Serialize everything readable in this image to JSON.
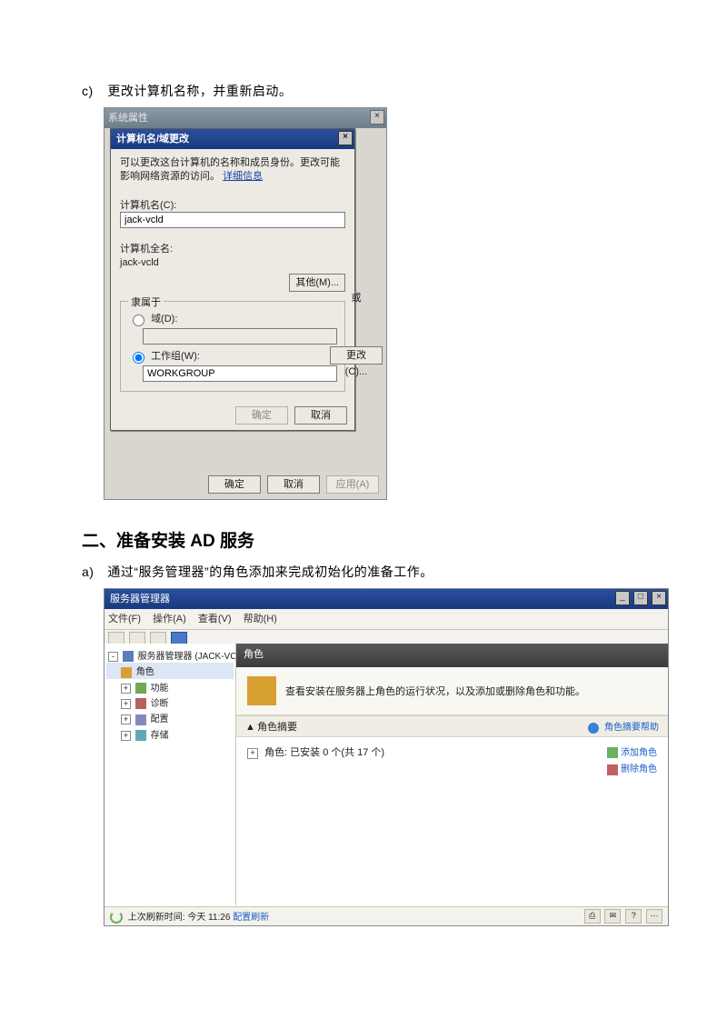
{
  "step_c": {
    "label": "c)",
    "text": "更改计算机名称，并重新启动。"
  },
  "shot1": {
    "outer_title": "系统属性",
    "inner_title": "计算机名/域更改",
    "desc_prefix": "可以更改这台计算机的名称和成员身份。更改可能影响网络资源的访问。",
    "desc_link": "详细信息",
    "computer_name_label": "计算机名(C):",
    "computer_name_value": "jack-vcld",
    "full_name_label": "计算机全名:",
    "full_name_value": "jack-vcld",
    "more_btn": "其他(M)...",
    "member_legend": "隶属于",
    "domain_radio": "域(D):",
    "workgroup_radio": "工作组(W):",
    "workgroup_value": "WORKGROUP",
    "ok": "确定",
    "cancel": "取消",
    "apply": "应用(A)",
    "outer_side_or": "或",
    "outer_side_change": "更改(C)..."
  },
  "heading2": "二、准备安装 AD 服务",
  "step_a": {
    "label": "a)",
    "text": "通过“服务管理器”的角色添加来完成初始化的准备工作。"
  },
  "shot2": {
    "title": "服务器管理器",
    "menu": {
      "file": "文件(F)",
      "action": "操作(A)",
      "view": "查看(V)",
      "help": "帮助(H)"
    },
    "tree": {
      "root": "服务器管理器 (JACK-VCLD)",
      "roles": "角色",
      "features": "功能",
      "diag": "诊断",
      "conf": "配置",
      "storage": "存储"
    },
    "main_header": "角色",
    "info_text": "查看安装在服务器上角色的运行状况，以及添加或删除角色和功能。",
    "section_title": "角色摘要",
    "section_help": "角色摘要帮助",
    "roles_count": "角色: 已安装 0 个(共 17 个)",
    "add_role": "添加角色",
    "remove_role": "删除角色",
    "status_prefix": "上次刷新时间: 今天 11:26 ",
    "status_link": "配置刷新"
  }
}
